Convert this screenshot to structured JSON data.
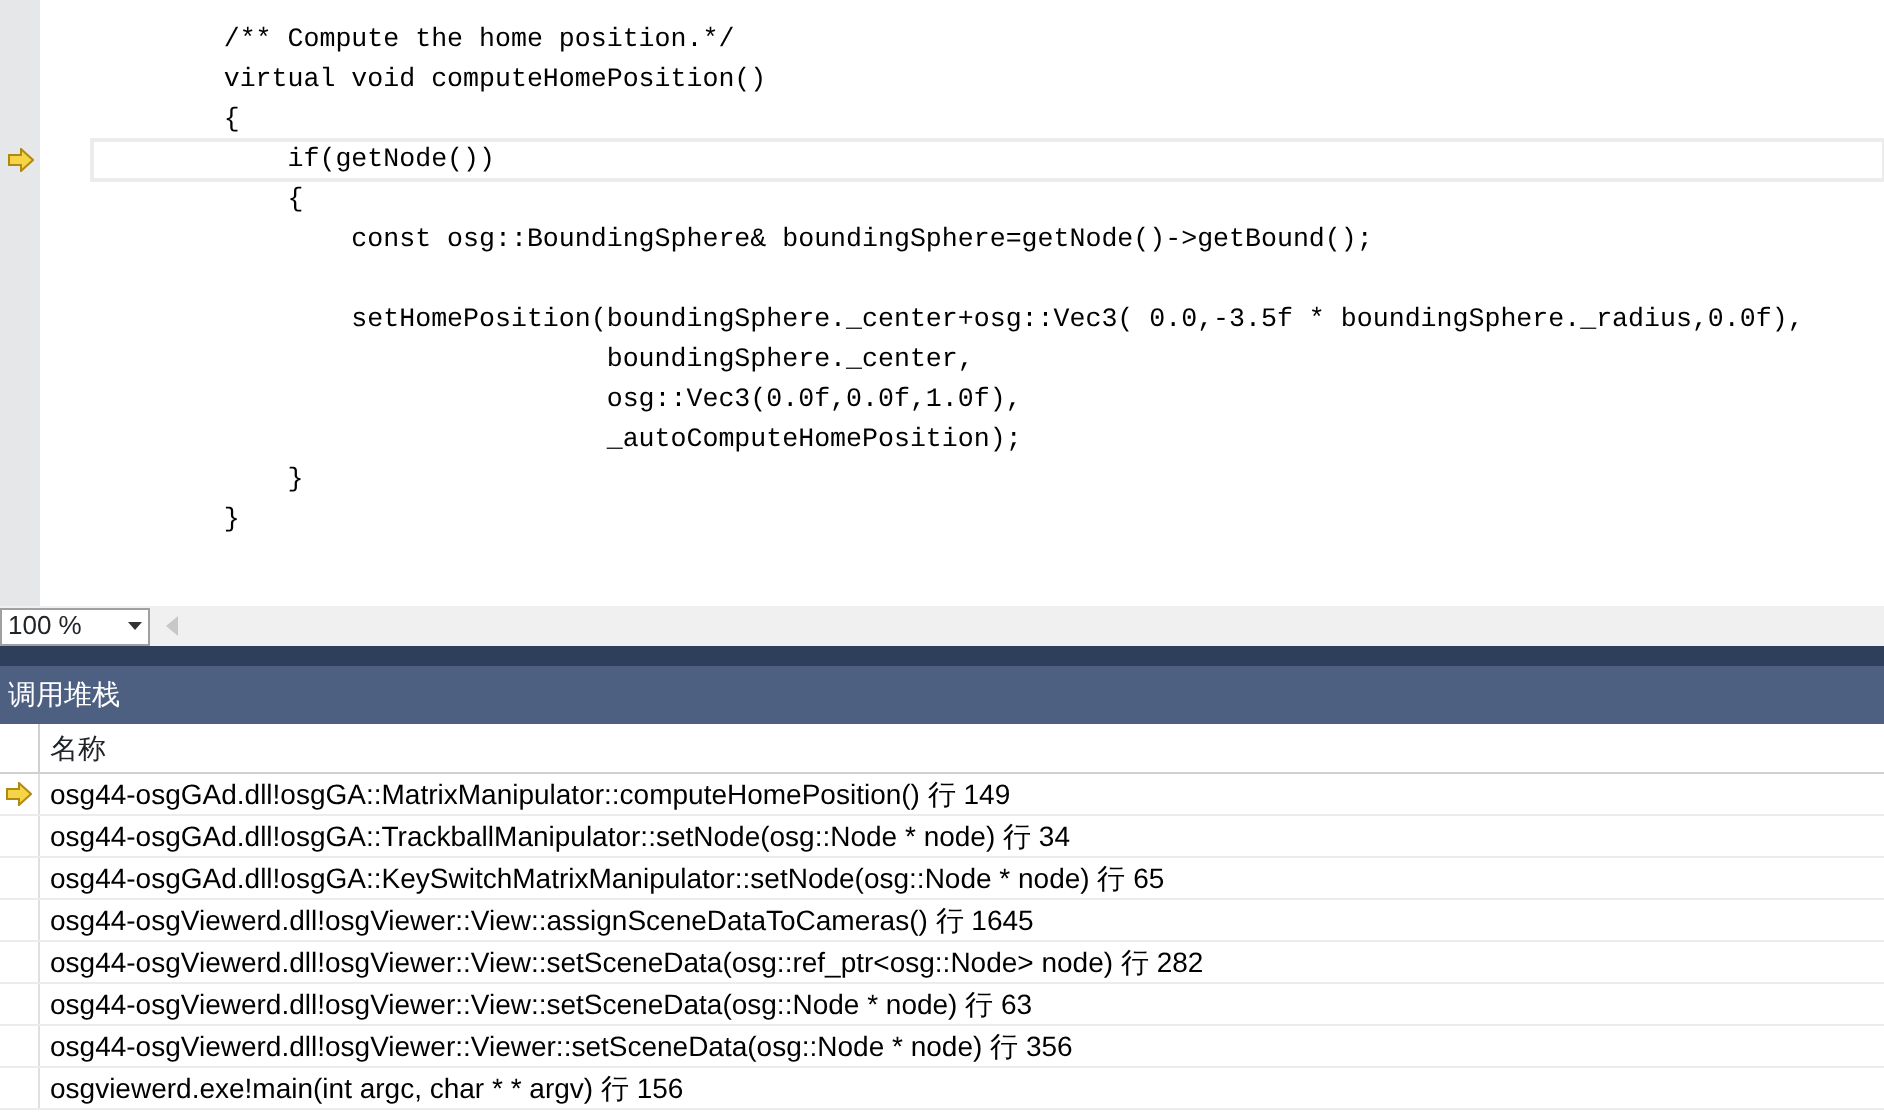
{
  "editor": {
    "lines": [
      {
        "text": "        /** Compute the home position.*/",
        "current": false
      },
      {
        "text": "        virtual void computeHomePosition()",
        "current": false
      },
      {
        "text": "        {",
        "current": false
      },
      {
        "text": "            if(getNode())",
        "current": true
      },
      {
        "text": "            {",
        "current": false
      },
      {
        "text": "                const osg::BoundingSphere& boundingSphere=getNode()->getBound();",
        "current": false
      },
      {
        "current": false
      },
      {
        "text": "                setHomePosition(boundingSphere._center+osg::Vec3( 0.0,-3.5f * boundingSphere._radius,0.0f),",
        "current": false
      },
      {
        "text": "                                boundingSphere._center,",
        "current": false
      },
      {
        "text": "                                osg::Vec3(0.0f,0.0f,1.0f),",
        "current": false
      },
      {
        "text": "                                _autoComputeHomePosition);",
        "current": false
      },
      {
        "text": "            }",
        "current": false
      },
      {
        "text": "        }",
        "current": false
      }
    ],
    "zoom": "100 %"
  },
  "call_stack": {
    "title": "调用堆栈",
    "columns": [
      "名称"
    ],
    "rows": [
      {
        "text": "osg44-osgGAd.dll!osgGA::MatrixManipulator::computeHomePosition() 行 149",
        "current": true
      },
      {
        "text": "osg44-osgGAd.dll!osgGA::TrackballManipulator::setNode(osg::Node * node) 行 34",
        "current": false
      },
      {
        "text": "osg44-osgGAd.dll!osgGA::KeySwitchMatrixManipulator::setNode(osg::Node * node) 行 65",
        "current": false
      },
      {
        "text": "osg44-osgViewerd.dll!osgViewer::View::assignSceneDataToCameras() 行 1645",
        "current": false
      },
      {
        "text": "osg44-osgViewerd.dll!osgViewer::View::setSceneData(osg::ref_ptr<osg::Node> node) 行 282",
        "current": false
      },
      {
        "text": "osg44-osgViewerd.dll!osgViewer::View::setSceneData(osg::Node * node) 行 63",
        "current": false
      },
      {
        "text": "osg44-osgViewerd.dll!osgViewer::Viewer::setSceneData(osg::Node * node) 行 356",
        "current": false
      },
      {
        "text": "osgviewerd.exe!main(int argc, char * * argv) 行 156",
        "current": false
      }
    ]
  }
}
